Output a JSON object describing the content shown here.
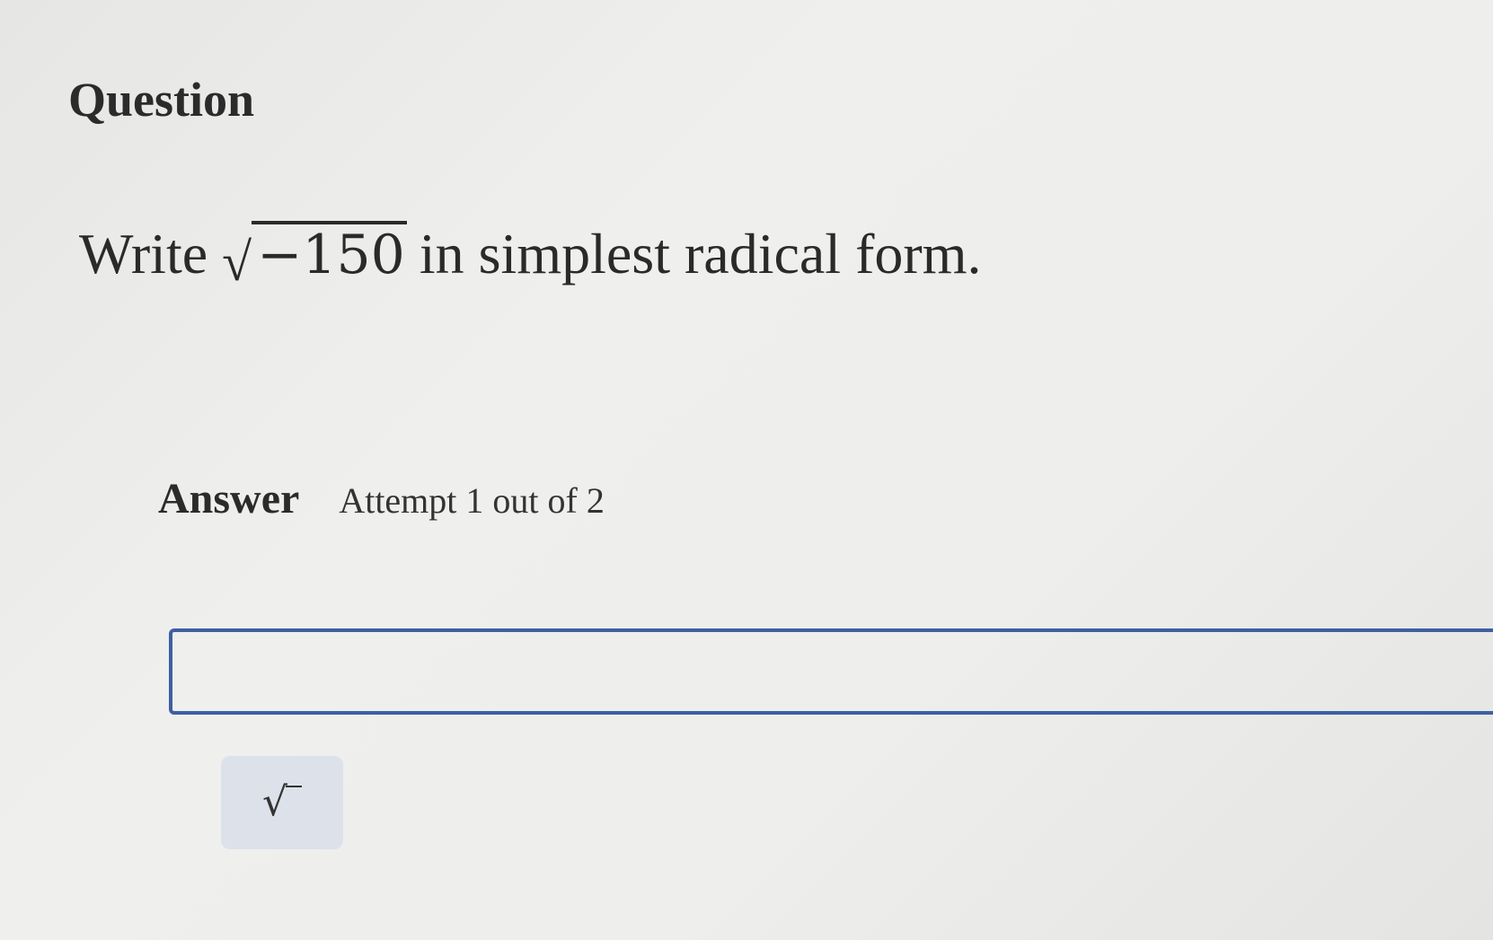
{
  "question": {
    "heading": "Question",
    "prompt_before": "Write",
    "radical_sign": "√",
    "radicand": "−150",
    "prompt_after": "in simplest radical form."
  },
  "answer": {
    "label": "Answer",
    "attempt": "Attempt 1 out of 2",
    "input_value": "",
    "input_placeholder": ""
  },
  "toolbar": {
    "sqrt_icon": "sqrt-icon",
    "sqrt_symbol": "√"
  },
  "colors": {
    "input_border": "#3e5fa3",
    "button_bg": "#dde2ea",
    "text": "#2a2a2a"
  }
}
